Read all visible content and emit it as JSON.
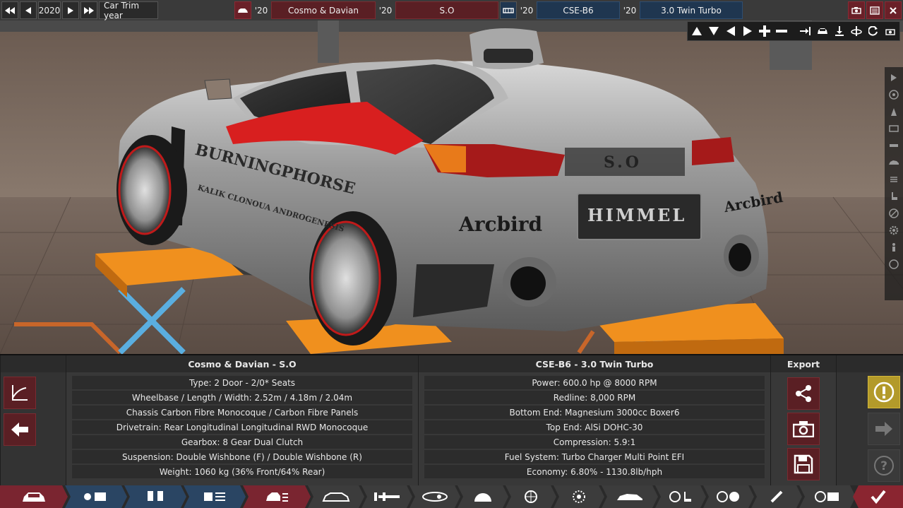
{
  "topbar": {
    "year": "2020",
    "trim_label": "Car Trim year",
    "model_year": "'20",
    "model_name": "Cosmo & Davian",
    "trim_year": "'20",
    "trim_name": "S.O",
    "family_year": "'20",
    "family_name": "CSE-B6",
    "variant_year": "'20",
    "variant_name": "3.0 Twin Turbo"
  },
  "car_panel": {
    "title": "Cosmo & Davian - S.O",
    "rows": [
      "Type: 2 Door - 2/0* Seats",
      "Wheelbase / Length / Width: 2.52m / 4.18m / 2.04m",
      "Chassis Carbon Fibre Monocoque / Carbon Fibre Panels",
      "Drivetrain: Rear Longitudinal Longitudinal RWD Monocoque",
      "Gearbox: 8 Gear Dual Clutch",
      "Suspension: Double Wishbone (F) / Double Wishbone (R)",
      "Weight: 1060 kg (36% Front/64% Rear)"
    ]
  },
  "engine_panel": {
    "title": "CSE-B6 - 3.0 Twin Turbo",
    "rows": [
      "Power: 600.0 hp @ 8000 RPM",
      "Redline:  8,000 RPM",
      "Bottom End: Magnesium 3000cc Boxer6",
      "Top End: AlSi DOHC-30",
      "Compression: 5.9:1",
      "Fuel System: Turbo Charger Multi Point EFI",
      "Economy: 6.80% - 1130.8lb/hph"
    ]
  },
  "export": {
    "title": "Export"
  },
  "colors": {
    "accent_red": "#7a2530",
    "accent_blue": "#2a4563",
    "warning_yellow": "#b39a2a"
  },
  "car_decals": {
    "brand": "Arcbird",
    "rear_badge": "S.O",
    "plate": "HIMMEL",
    "side_text": "BURNINGPHORSE",
    "side_text2": "KALIK CLONOUA ANDROGENESIS"
  }
}
